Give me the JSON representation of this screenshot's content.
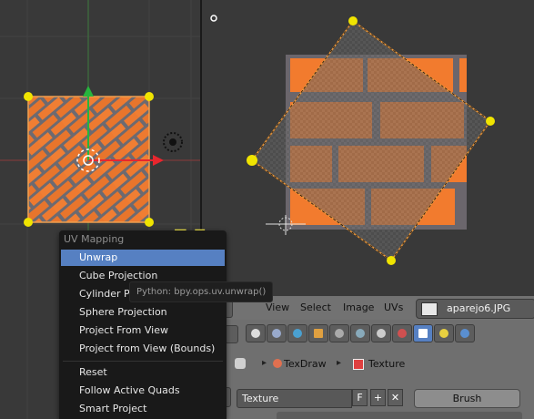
{
  "uv_menu": {
    "title": "UV Mapping",
    "items": [
      {
        "label": "Unwrap",
        "selected": true
      },
      {
        "label": "Cube Projection"
      },
      {
        "label": "Cylinder Pr"
      },
      {
        "label": "Sphere Projection"
      },
      {
        "label": "Project From View"
      },
      {
        "label": "Project from View (Bounds)"
      },
      {
        "label": "Reset"
      },
      {
        "label": "Follow Active Quads"
      },
      {
        "label": "Smart Project"
      }
    ]
  },
  "hotkey_overlay": "U",
  "tooltip": "Python: bpy.ops.uv.unwrap()",
  "uv_header": {
    "menus": [
      "View",
      "Select",
      "Image",
      "UVs"
    ],
    "image_name": "aparejo6.JPG"
  },
  "properties": {
    "path": [
      "TexDraw",
      "Texture"
    ],
    "texture_field": "Texture",
    "fake_user": "F",
    "brush_button": "Brush"
  },
  "icons": [
    "scene-icon",
    "render-icon",
    "world-icon",
    "object-icon",
    "constraint-icon",
    "modifier-icon",
    "data-icon",
    "material-icon",
    "texture-icon",
    "particles-icon",
    "physics-icon"
  ],
  "colors": {
    "accent": "#5680c2",
    "hotkey": "#f0e44a",
    "vertex": "#f0e400",
    "x_axis": "#e8262e",
    "y_axis": "#27b53d"
  }
}
